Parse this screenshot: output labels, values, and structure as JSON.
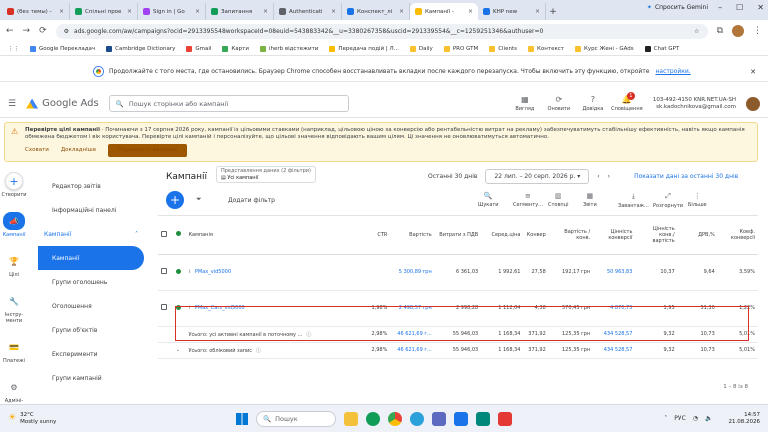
{
  "browser": {
    "tabs": [
      {
        "label": "(без темы) -",
        "color": "#d93025"
      },
      {
        "label": "Спільні прое",
        "color": "#0f9d58"
      },
      {
        "label": "Sign in | Go",
        "color": "#a142f4"
      },
      {
        "label": "Запитання",
        "color": "#0f9d58"
      },
      {
        "label": "Authenticati",
        "color": "#5f6368"
      },
      {
        "label": "Конспект_лі",
        "color": "#1a73e8"
      },
      {
        "label": "Кампанії - ",
        "color": "#fbbc04"
      },
      {
        "label": "KHP new",
        "color": "#1a73e8"
      }
    ],
    "gemini": "Спросить Gemini",
    "url": "ads.google.com/aw/campaigns?ocid=2913395548workspaceId=08euid=543883342&__u=3380267358&uscid=291339554&__c=1259251346&authuser=0",
    "bookmarks": [
      "Google Перекладач",
      "Cambridge Dictionary",
      "Gmail",
      "Карти",
      "iherb відстежити",
      "Передача подій | Л...",
      "Daily",
      "PRO GTM",
      "Clients",
      "Контекст",
      "Курс Жені - GAds",
      "Chat GPT"
    ],
    "restore_text": "Продолжайте с того места, где остановились. Браузер Chrome способен восстанавливать вкладки после каждого перезапуска. Чтобы включить эту функцию, откройте",
    "restore_link": "настройки."
  },
  "ads": {
    "product": "Google Ads",
    "search_placeholder": "Пошук сторінки або кампанії",
    "top_icons": [
      {
        "label": "Вигляд",
        "glyph": "▦"
      },
      {
        "label": "Оновити",
        "glyph": "⟳"
      },
      {
        "label": "Довідка",
        "glyph": "?"
      },
      {
        "label": "Сповіщення",
        "glyph": "🔔"
      }
    ],
    "notification_count": "1",
    "account_id": "103-492-4150 KNR.NET.UA-SH",
    "account_email": "sk.kadochnikova@gmail.com",
    "warning": {
      "bold": "Перевірте цілі кампанії",
      "text": "· Починаючи з 17 серпня 2026 року, кампанії із цільовими ставками (наприклад, цільовою ціною за конверсію або рентабельністю витрат на рекламу) забезпечуватимуть стабільнішу ефективність, навіть якщо кампанія обмежена бюджетом і вік користувача. Перевірте цілі кампаній і персоналізуйте, що цільові значення відповідають вашим цілям. Ці значення не оновлюватимуться автоматично.",
      "dismiss": "Сховати",
      "more": "Докладніше",
      "button": "Перевірити кампанії"
    },
    "rail": [
      {
        "label": "Створити",
        "glyph": "+"
      },
      {
        "label": "Кампанії",
        "glyph": "📣"
      },
      {
        "label": "Цілі",
        "glyph": "🏆"
      },
      {
        "label": "Інстру-менти",
        "glyph": "🔧"
      },
      {
        "label": "Платежі",
        "glyph": "💳"
      },
      {
        "label": "Адміні-стратор",
        "glyph": "⚙"
      }
    ],
    "sidebar": [
      {
        "label": "Редактор звітів"
      },
      {
        "label": "Інформаційні панелі"
      },
      {
        "label": "Кампанії",
        "head": true
      },
      {
        "label": "Кампанії",
        "selected": true
      },
      {
        "label": "Групи оголошень"
      },
      {
        "label": "Оголошення"
      },
      {
        "label": "Групи об'єктів"
      },
      {
        "label": "Експерименти"
      },
      {
        "label": "Групи кампаній"
      }
    ],
    "main": {
      "title": "Кампанії",
      "view_caption": "Представлення даних (2 фільтри)",
      "view_value": "Усі кампанії",
      "date_label": "Останні 30 днів",
      "date_range": "22 лип. – 20 серп. 2026 р.",
      "show_link": "Показати дані за останні 30 днів",
      "add_filter": "Додати фільтр",
      "tools": [
        "Шукати",
        "Сегменту...",
        "Стовпці",
        "Звіти",
        "Завантаж...",
        "Розгорнути",
        "Більше"
      ],
      "columns": [
        "Кампанія",
        "CTR",
        "Вартість",
        "Витрати з ПДВ",
        "Серед.ціна",
        "Конвер",
        "Вартість / конв.",
        "Цінність конверсії",
        "Цінність конв./ вартість",
        "ДРВ,%",
        "Коеф. конверсії"
      ],
      "rows": [
        {
          "name": "PMax_vid5000",
          "cells": [
            "",
            "5 300,89 грн",
            "6 361,03",
            "1 992,61",
            "27,58",
            "192,17 грн",
            "50 963,83",
            "10,37",
            "9,64",
            "3,59%"
          ],
          "highlight": false
        },
        {
          "name": "PMax_Cars_vid5000",
          "cells": [
            "1,98%",
            "2 498,57 грн",
            "2 998,28",
            "1 112,04",
            "4,38",
            "570,45 грн",
            "4 870,75",
            "1,95",
            "51,30",
            "1,22%"
          ],
          "highlight": true
        }
      ],
      "totals": [
        {
          "label": "Усього: усі активні кампанії в поточному ...",
          "cells": [
            "2,98%",
            "46 621,69 г...",
            "55 946,03",
            "1 168,34",
            "371,92",
            "125,35 грн",
            "434 528,57",
            "9,32",
            "10,73",
            "5,01%"
          ]
        },
        {
          "label": "Усього: обліковий запис",
          "cells": [
            "2,98%",
            "46 621,69 г...",
            "55 946,03",
            "1 168,34",
            "371,92",
            "125,35 грн",
            "434 528,57",
            "9,32",
            "10,73",
            "5,01%"
          ]
        }
      ],
      "pager": "1 – 8 із 8"
    }
  },
  "taskbar": {
    "temp": "32°C",
    "weather": "Mostly sunny",
    "search": "Пошук",
    "lang": "РУС",
    "time": "14:57",
    "date": "21.08.2026"
  }
}
